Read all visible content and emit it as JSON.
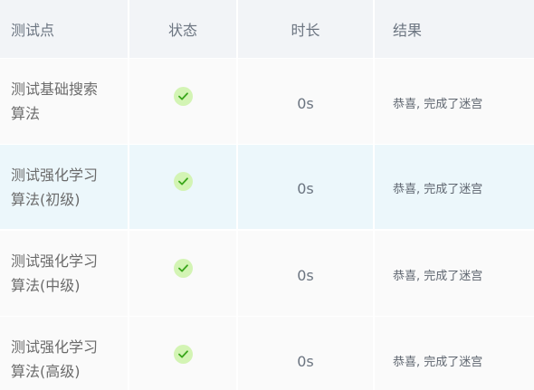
{
  "columns": {
    "test_point": "测试点",
    "status": "状态",
    "duration": "时长",
    "result": "结果"
  },
  "rows": [
    {
      "name": "测试基础搜索算法",
      "status": "check-circle-icon",
      "duration": "0s",
      "result": "恭喜, 完成了迷宫"
    },
    {
      "name": "测试强化学习算法(初级)",
      "status": "check-circle-icon",
      "duration": "0s",
      "result": "恭喜, 完成了迷宫"
    },
    {
      "name": "测试强化学习算法(中级)",
      "status": "check-circle-icon",
      "duration": "0s",
      "result": "恭喜, 完成了迷宫"
    },
    {
      "name": "测试强化学习算法(高级)",
      "status": "check-circle-icon",
      "duration": "0s",
      "result": "恭喜, 完成了迷宫"
    }
  ],
  "colors": {
    "header_bg": "#f2f4f7",
    "highlight_row_bg": "#ecf7fb",
    "success_bg": "#d3f4b4",
    "success_check": "#3aa61b"
  }
}
